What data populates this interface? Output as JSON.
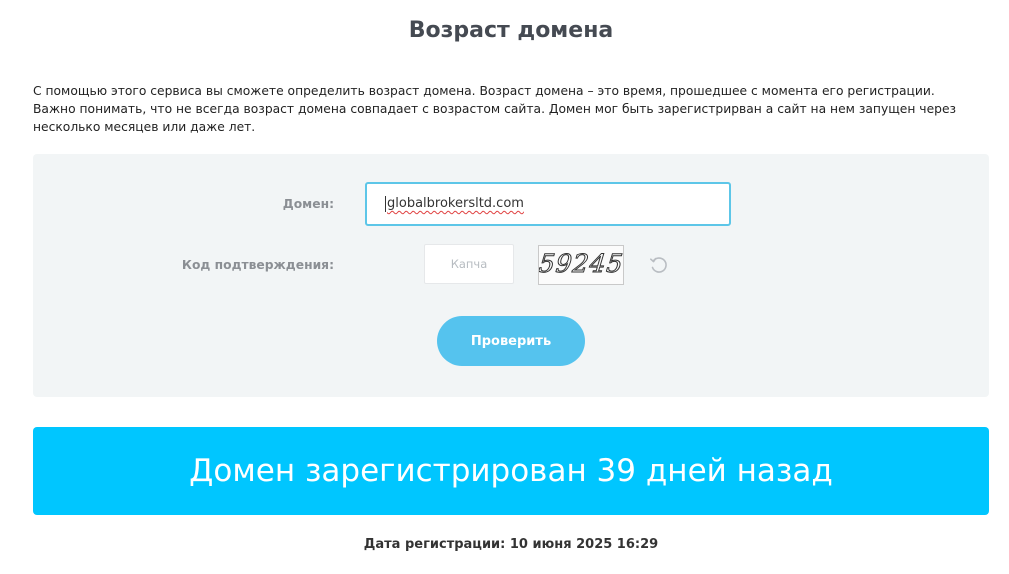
{
  "page": {
    "title": "Возраст домена",
    "description": "С помощью этого сервиса вы сможете определить возраст домена. Возраст домена – это время, прошедшее с момента его регистрации. Важно понимать, что не всегда возраст домена совпадает с возрастом сайта. Домен мог быть зарегистрирван а сайт на нем запущен через несколько месяцев или даже лет."
  },
  "form": {
    "domain_label": "Домен:",
    "domain_value": "globalbrokersltd.com",
    "code_label": "Код подтверждения:",
    "captcha_placeholder": "Капча",
    "captcha_value": "",
    "captcha_image_text": "59245",
    "refresh_icon": "refresh-icon",
    "submit_label": "Проверить"
  },
  "result": {
    "banner_text": "Домен зарегистрирован 39 дней назад",
    "registration_date": "Дата регистрации: 10 июня 2025 16:29"
  },
  "colors": {
    "accent": "#00c6ff",
    "button": "#55c3ee",
    "input_focus": "#5dc6e8",
    "panel": "#f2f5f6"
  }
}
